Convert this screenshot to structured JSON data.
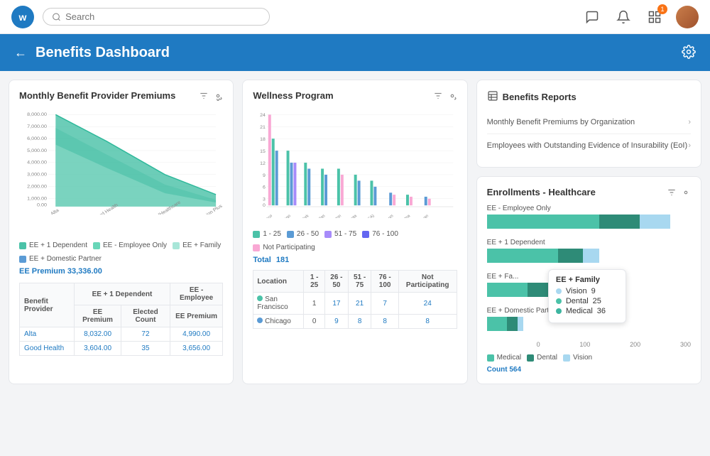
{
  "topnav": {
    "logo_text": "w",
    "search_placeholder": "Search",
    "notification_badge": "1"
  },
  "header": {
    "title": "Benefits Dashboard",
    "back_label": "←"
  },
  "monthly_premiums": {
    "card_title": "Monthly Benefit Provider Premiums",
    "y_labels": [
      "8,000.00",
      "7,000.00",
      "6,000.00",
      "5,000.00",
      "4,000.00",
      "3,000.00",
      "2,000.00",
      "1,000.00",
      "0.00"
    ],
    "x_labels": [
      "Alta",
      "Good Health",
      "UnitedHealthcare",
      "Vision Plus"
    ],
    "legend": [
      {
        "label": "EE + 1 Dependent",
        "color": "#4bc2a8"
      },
      {
        "label": "EE - Employee Only",
        "color": "#68d6b8"
      },
      {
        "label": "EE + Family",
        "color": "#a8e6d8"
      },
      {
        "label": "EE + Domestic Partner",
        "color": "#5b9bd5"
      }
    ],
    "ee_premium_label": "EE Premium",
    "ee_premium_value": "33,336.00",
    "table": {
      "headers": [
        "Benefit Provider",
        "EE + 1 Dependent",
        "",
        "EE - Employee"
      ],
      "sub_headers": [
        "",
        "EE Premium",
        "Elected Count",
        "EE Premium"
      ],
      "rows": [
        {
          "provider": "Alta",
          "ee1_premium": "8,032.00",
          "elected": "72",
          "ee_premium": "4,990.00"
        },
        {
          "provider": "Good Health",
          "ee1_premium": "3,604.00",
          "elected": "35",
          "ee_premium": "3,656.00"
        }
      ]
    }
  },
  "wellness": {
    "card_title": "Wellness Program",
    "y_labels": [
      "24",
      "21",
      "18",
      "15",
      "12",
      "9",
      "6",
      "3",
      "0"
    ],
    "x_labels": [
      "San Francisco",
      "Chicago",
      "New York",
      "Dallas",
      "Boston",
      "Atlanta",
      "Home Office (USA)",
      "Benuys",
      "Hagatna",
      "San Juan"
    ],
    "legend": [
      {
        "label": "1 - 25",
        "color": "#4bc2a8"
      },
      {
        "label": "26 - 50",
        "color": "#5b9bd5"
      },
      {
        "label": "51 - 75",
        "color": "#a78bfa"
      },
      {
        "label": "76 - 100",
        "color": "#6366f1"
      },
      {
        "label": "Not Participating",
        "color": "#f9a8d4"
      }
    ],
    "total_label": "Total",
    "total_value": "181",
    "table": {
      "headers": [
        "Location",
        "1 - 25",
        "26 - 50",
        "51 - 75",
        "76 - 100",
        "Not Participating"
      ],
      "rows": [
        {
          "location": "San Francisco",
          "loc_color": "#4bc2a8",
          "v1": "1",
          "v2": "17",
          "v3": "21",
          "v4": "7",
          "v5": "24"
        },
        {
          "location": "Chicago",
          "loc_color": "#5b9bd5",
          "v1": "0",
          "v2": "9",
          "v3": "8",
          "v4": "8",
          "v5": "8"
        }
      ]
    }
  },
  "benefits_reports": {
    "card_title": "Benefits Reports",
    "icon": "📋",
    "items": [
      {
        "label": "Monthly Benefit Premiums by Organization"
      },
      {
        "label": "Employees with Outstanding Evidence of Insurability (EoI)"
      }
    ]
  },
  "enrollments": {
    "card_title": "Enrollments - Healthcare",
    "rows": [
      {
        "label": "EE - Employee Only",
        "segs": [
          {
            "color": "#4bc2a8",
            "pct": 55
          },
          {
            "color": "#3db5a0",
            "pct": 20
          },
          {
            "color": "#5b9bd5",
            "pct": 15
          }
        ]
      },
      {
        "label": "EE + 1 Dependent",
        "segs": [
          {
            "color": "#4bc2a8",
            "pct": 35
          },
          {
            "color": "#3db5a0",
            "pct": 10
          },
          {
            "color": "#5b9bd5",
            "pct": 8
          }
        ]
      },
      {
        "label": "EE + Fa...",
        "segs": [
          {
            "color": "#4bc2a8",
            "pct": 20
          },
          {
            "color": "#3db5a0",
            "pct": 12
          },
          {
            "color": "#5b9bd5",
            "pct": 6
          }
        ]
      },
      {
        "label": "EE + Domestic Part...",
        "segs": [
          {
            "color": "#4bc2a8",
            "pct": 10
          },
          {
            "color": "#3db5a0",
            "pct": 5
          },
          {
            "color": "#5b9bd5",
            "pct": 3
          }
        ]
      }
    ],
    "x_labels": [
      "0",
      "100",
      "200",
      "300"
    ],
    "tooltip": {
      "title": "EE + Family",
      "items": [
        {
          "label": "Vision",
          "value": "9",
          "color": "#a8d8f0"
        },
        {
          "label": "Dental",
          "value": "25",
          "color": "#4bc2a8"
        },
        {
          "label": "Medical",
          "value": "36",
          "color": "#3db5a0"
        }
      ]
    },
    "legend": [
      {
        "label": "Medical",
        "color": "#4bc2a8"
      },
      {
        "label": "Dental",
        "color": "#3db5a0"
      },
      {
        "label": "Vision",
        "color": "#a8d8f0"
      }
    ],
    "count_label": "Count",
    "count_value": "564"
  }
}
